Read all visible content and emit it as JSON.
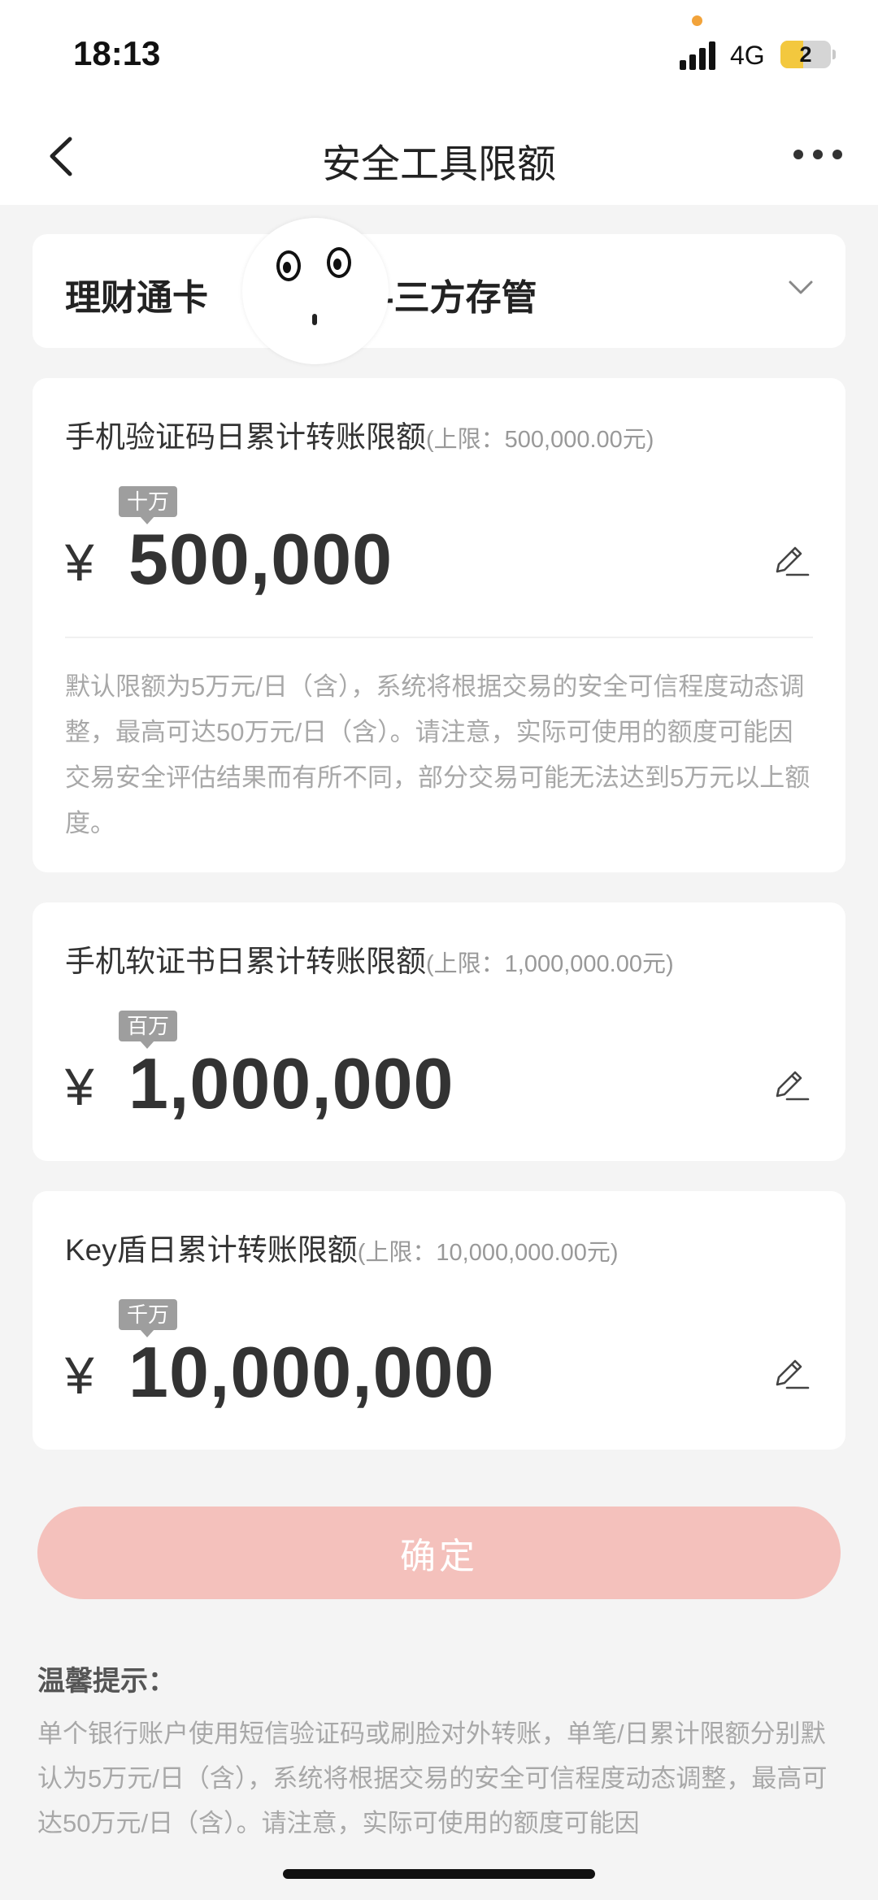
{
  "status_bar": {
    "time": "18:13",
    "network": "4G",
    "battery": "2"
  },
  "nav": {
    "title": "安全工具限额"
  },
  "account": {
    "label": "理财通卡",
    "label2": "-三方存管"
  },
  "limits": [
    {
      "title": "手机验证码日累计转账限额",
      "cap": "(上限：500,000.00元)",
      "unit_tag": "十万",
      "currency": "¥",
      "amount": "500,000",
      "description": "默认限额为5万元/日（含），系统将根据交易的安全可信程度动态调整，最高可达50万元/日（含）。请注意，实际可使用的额度可能因交易安全评估结果而有所不同，部分交易可能无法达到5万元以上额度。"
    },
    {
      "title": "手机软证书日累计转账限额",
      "cap": "(上限：1,000,000.00元)",
      "unit_tag": "百万",
      "currency": "¥",
      "amount": "1,000,000"
    },
    {
      "title": "Key盾日累计转账限额",
      "cap": "(上限：10,000,000.00元)",
      "unit_tag": "千万",
      "currency": "¥",
      "amount": "10,000,000"
    }
  ],
  "confirm_label": "确定",
  "tips": {
    "title": "温馨提示：",
    "text": "单个银行账户使用短信验证码或刷脸对外转账，单笔/日累计限额分别默认为5万元/日（含），系统将根据交易的安全可信程度动态调整，最高可达50万元/日（含）。请注意，实际可使用的额度可能因"
  },
  "colors": {
    "accent_disabled": "#f4c1bc",
    "tag": "#9e9e9e",
    "battery": "#f3c83e",
    "dot": "#f2a33a"
  }
}
